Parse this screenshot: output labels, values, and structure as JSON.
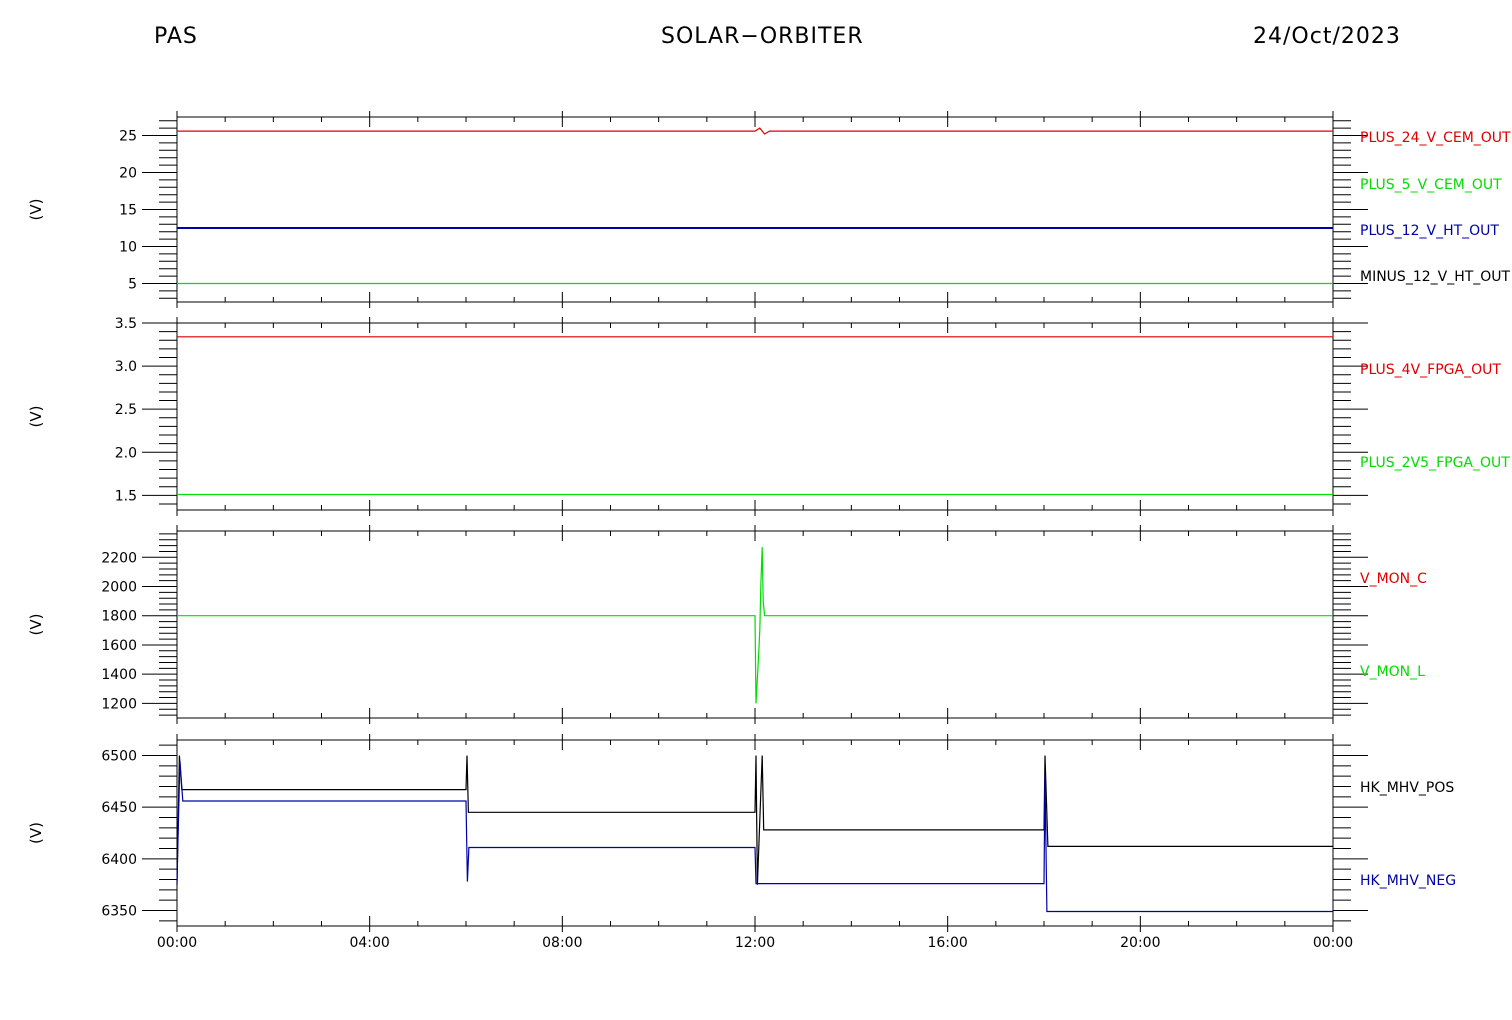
{
  "header": {
    "left": "PAS",
    "center": "SOLAR−ORBITER",
    "right": "24/Oct/2023"
  },
  "colors": {
    "red": "#e00000",
    "green": "#00dd00",
    "blue": "#0000aa",
    "black": "#000000"
  },
  "chart_data": [
    {
      "type": "line",
      "ylabel": "(V)",
      "ylim": [
        2.5,
        27.5
      ],
      "yticks": [
        5,
        10,
        15,
        20,
        25
      ],
      "series": [
        {
          "name": "PLUS_24_V_CEM_OUT",
          "color": "red",
          "points": [
            [
              0,
              25.6
            ],
            [
              12.0,
              25.6
            ],
            [
              12.1,
              26.0
            ],
            [
              12.2,
              25.2
            ],
            [
              12.3,
              25.6
            ],
            [
              24,
              25.6
            ]
          ]
        },
        {
          "name": "PLUS_5_V_CEM_OUT",
          "color": "green",
          "points": [
            [
              0,
              5.0
            ],
            [
              24,
              5.0
            ]
          ]
        },
        {
          "name": "PLUS_12_V_HT_OUT",
          "color": "blue",
          "points": [
            [
              0,
              12.5
            ],
            [
              24,
              12.5
            ]
          ]
        },
        {
          "name": "MINUS_12_V_HT_OUT",
          "color": "black",
          "points": []
        }
      ]
    },
    {
      "type": "line",
      "ylabel": "(V)",
      "ylim": [
        1.33,
        3.5
      ],
      "yticks": [
        1.5,
        2.0,
        2.5,
        3.0,
        3.5
      ],
      "series": [
        {
          "name": "PLUS_4V_FPGA_OUT",
          "color": "red",
          "points": [
            [
              0,
              3.34
            ],
            [
              24,
              3.34
            ]
          ]
        },
        {
          "name": "PLUS_2V5_FPGA_OUT",
          "color": "green",
          "points": [
            [
              0,
              1.51
            ],
            [
              24,
              1.51
            ]
          ]
        }
      ]
    },
    {
      "type": "line",
      "ylabel": "(V)",
      "ylim": [
        1100,
        2380
      ],
      "yticks": [
        1200,
        1400,
        1600,
        1800,
        2000,
        2200
      ],
      "series": [
        {
          "name": "V_MON_C",
          "color": "red",
          "points": []
        },
        {
          "name": "V_MON_L",
          "color": "green",
          "points": [
            [
              0,
              1800
            ],
            [
              12.0,
              1800
            ],
            [
              12.02,
              1200
            ],
            [
              12.07,
              1500
            ],
            [
              12.1,
              1700
            ],
            [
              12.12,
              2000
            ],
            [
              12.15,
              2270
            ],
            [
              12.17,
              1900
            ],
            [
              12.2,
              1800
            ],
            [
              24,
              1800
            ]
          ]
        }
      ]
    },
    {
      "type": "line",
      "ylabel": "(V)",
      "ylim": [
        6335,
        6515
      ],
      "yticks": [
        6350,
        6400,
        6450,
        6500
      ],
      "series": [
        {
          "name": "HK_MHV_POS",
          "color": "black",
          "points": [
            [
              0,
              6375
            ],
            [
              0.05,
              6500
            ],
            [
              0.1,
              6467
            ],
            [
              6.0,
              6467
            ],
            [
              6.02,
              6500
            ],
            [
              6.05,
              6445
            ],
            [
              12.0,
              6445
            ],
            [
              12.02,
              6500
            ],
            [
              12.05,
              6375
            ],
            [
              12.15,
              6500
            ],
            [
              12.18,
              6428
            ],
            [
              18.0,
              6428
            ],
            [
              18.02,
              6500
            ],
            [
              18.08,
              6412
            ],
            [
              24,
              6412
            ]
          ]
        },
        {
          "name": "HK_MHV_NEG",
          "color": "blue",
          "points": [
            [
              0,
              6378
            ],
            [
              0.06,
              6495
            ],
            [
              0.12,
              6456
            ],
            [
              6.0,
              6456
            ],
            [
              6.03,
              6378
            ],
            [
              6.06,
              6411
            ],
            [
              12.0,
              6411
            ],
            [
              12.02,
              6376
            ],
            [
              18.0,
              6376
            ],
            [
              18.02,
              6480
            ],
            [
              18.06,
              6349
            ],
            [
              24,
              6349
            ]
          ]
        }
      ]
    }
  ],
  "xaxis": {
    "range_hours": [
      0,
      24
    ],
    "ticks": [
      "00:00",
      "04:00",
      "08:00",
      "12:00",
      "16:00",
      "20:00",
      "00:00"
    ]
  }
}
